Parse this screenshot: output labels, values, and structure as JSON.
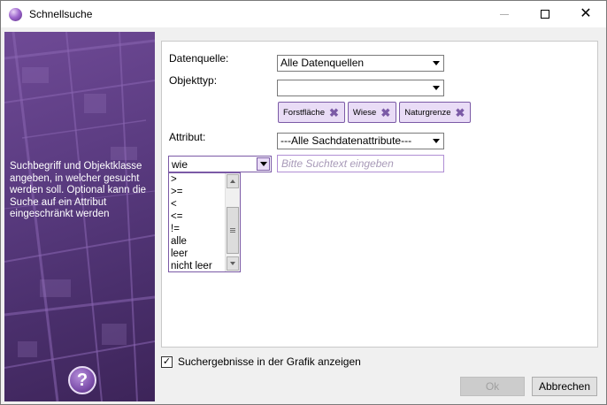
{
  "window": {
    "title": "Schnellsuche"
  },
  "sidebar": {
    "description": "Suchbegriff und Objektklasse angeben, in welcher gesucht werden soll. Optional kann die Suche auf ein Attribut eingeschränkt werden",
    "help_label": "?"
  },
  "form": {
    "datenquelle_label": "Datenquelle:",
    "datenquelle_value": "Alle Datenquellen",
    "objekttyp_label": "Objekttyp:",
    "objekttyp_value": "",
    "tags": [
      {
        "label": "Forstfläche"
      },
      {
        "label": "Wiese"
      },
      {
        "label": "Naturgrenze"
      }
    ],
    "attribut_label": "Attribut:",
    "attribut_value": "---Alle Sachdatenattribute---",
    "operator_value": "wie",
    "operator_options": [
      ">",
      ">=",
      "<",
      "<=",
      "!=",
      "alle",
      "leer",
      "nicht leer"
    ],
    "search_placeholder": "Bitte Suchtext eingeben"
  },
  "footer": {
    "checkbox_label": "Suchergebnisse in der Grafik anzeigen",
    "checkbox_checked": true,
    "ok_label": "Ok",
    "cancel_label": "Abbrechen"
  },
  "colors": {
    "accent": "#7b5aa6",
    "tag_fill": "#e9dcf6",
    "sidebar": "#5a3b80"
  }
}
